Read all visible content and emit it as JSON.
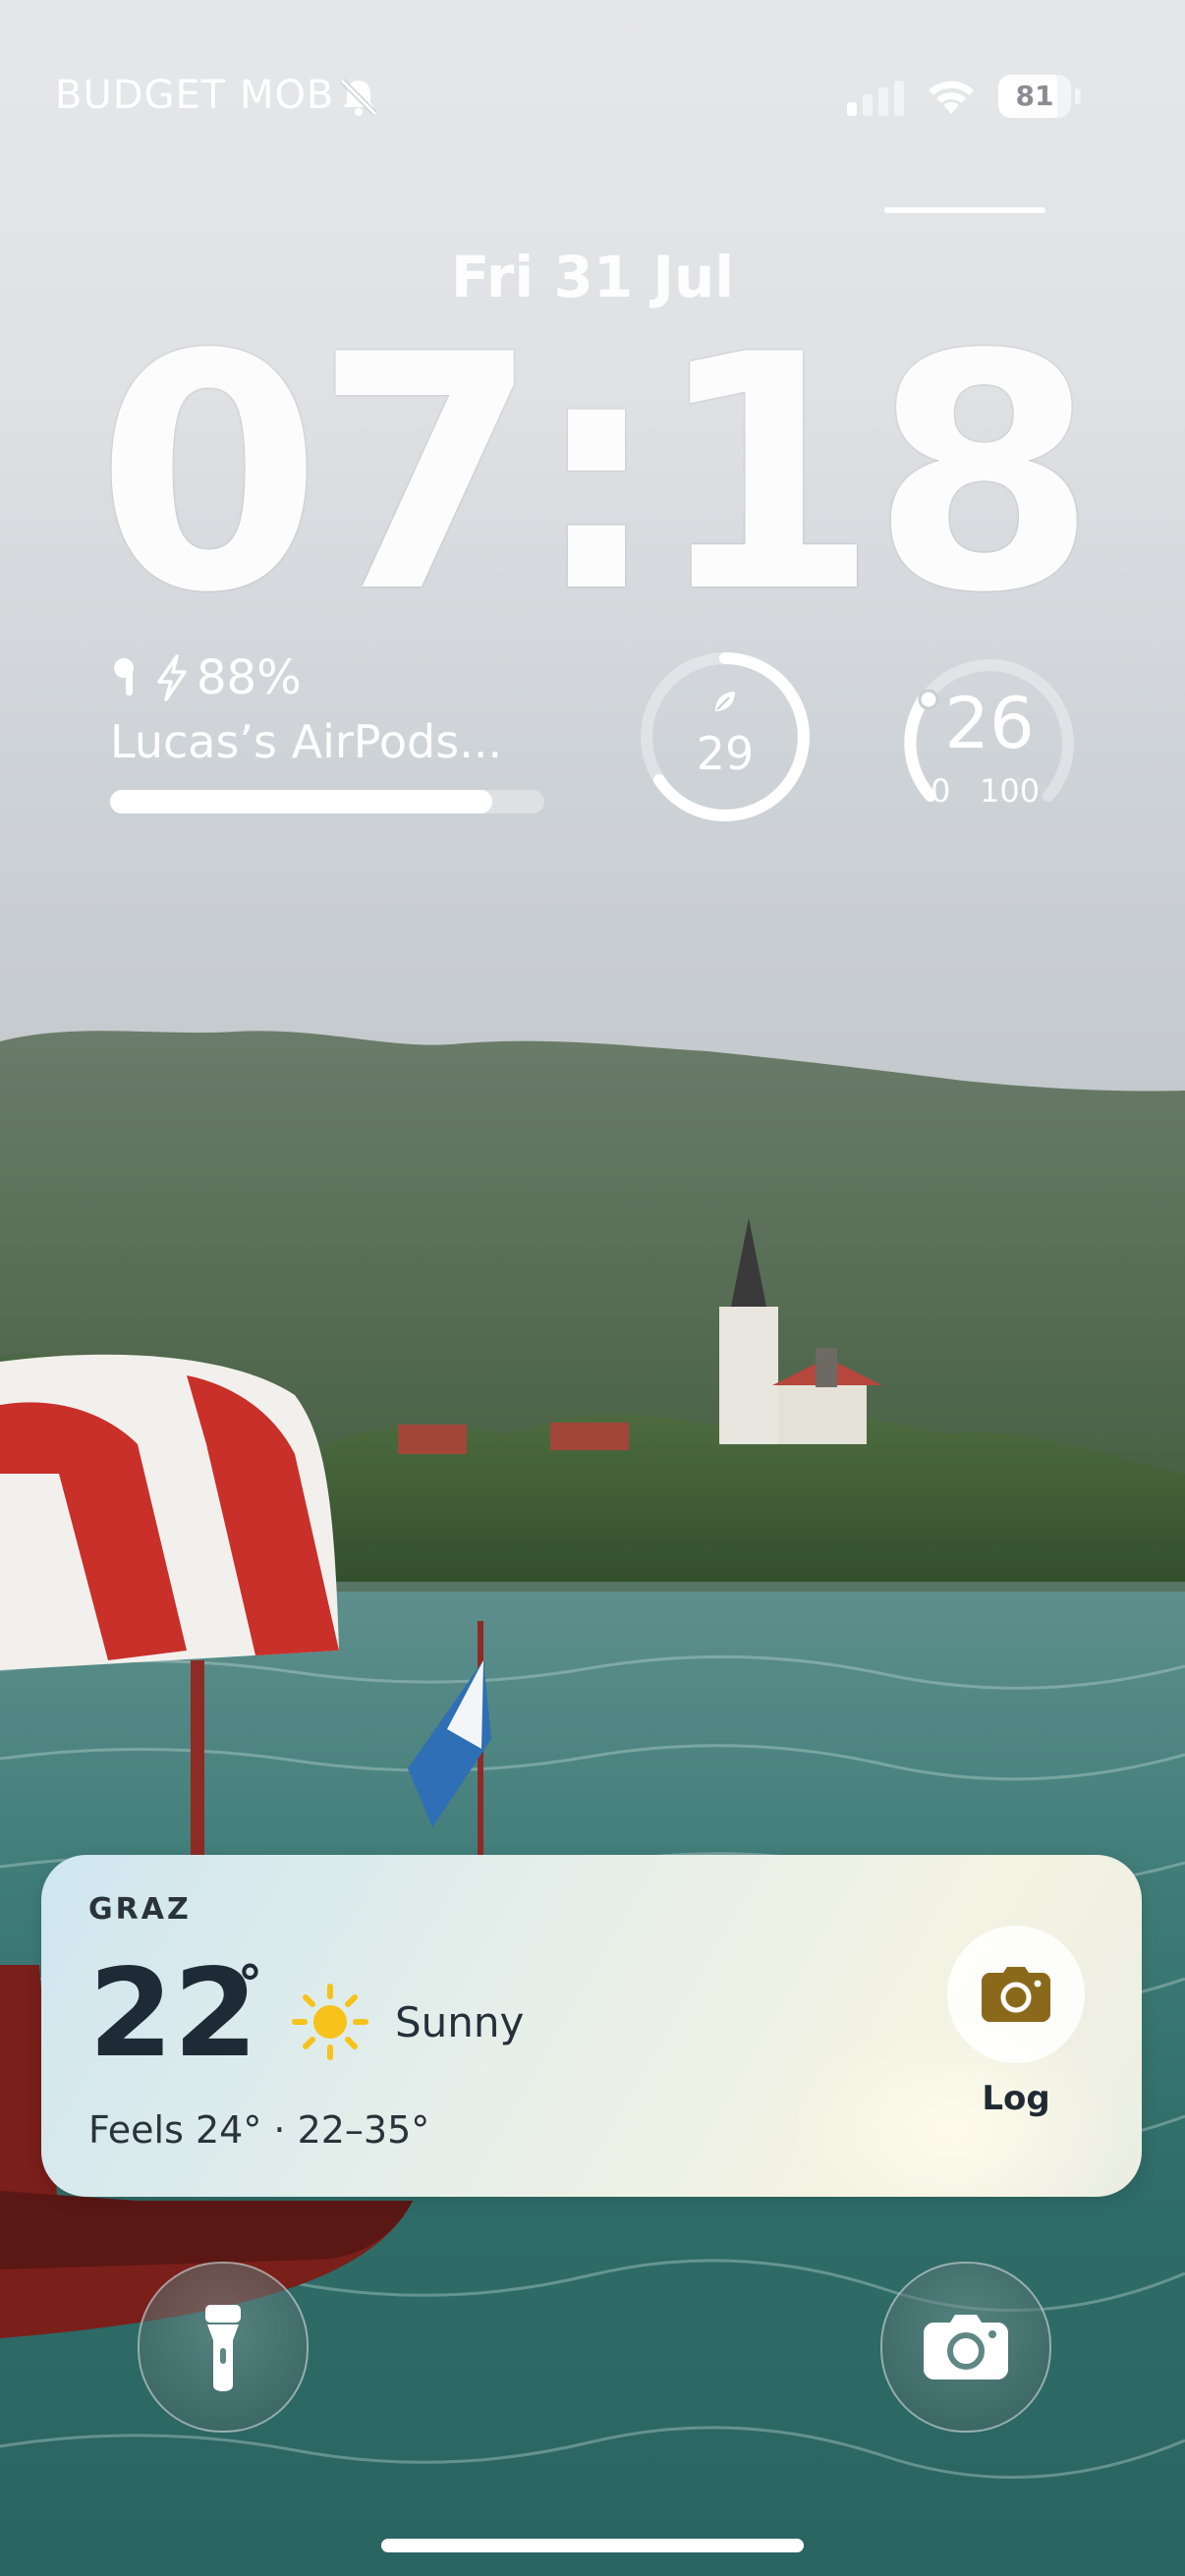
{
  "status_bar": {
    "carrier": "BUDGET MOB",
    "silent_icon": "bell-slash-icon",
    "signal_icon": "cellular-signal-icon",
    "wifi_icon": "wifi-icon",
    "battery_percent": "81"
  },
  "lock_screen": {
    "date": "Fri 31 Jul",
    "time": "07:18"
  },
  "widgets": {
    "airpods": {
      "icon": "airpod-icon",
      "charging_icon": "bolt-icon",
      "battery": "88%",
      "name": "Lucas’s AirPods...",
      "battery_fraction": 0.88
    },
    "gauge_one": {
      "icon": "leaf-icon",
      "value": "29"
    },
    "gauge_two": {
      "value": "26",
      "min": "0",
      "max": "100"
    }
  },
  "weather": {
    "city": "GRAZ",
    "temperature": "22",
    "degree": "°",
    "condition_icon": "sun-icon",
    "condition": "Sunny",
    "feels": "Feels 24° · 22–35°",
    "log_icon": "camera-icon",
    "log_label": "Log",
    "accent": "#8a6a1a"
  },
  "quick_actions": {
    "left_icon": "flashlight-icon",
    "right_icon": "camera-icon"
  }
}
